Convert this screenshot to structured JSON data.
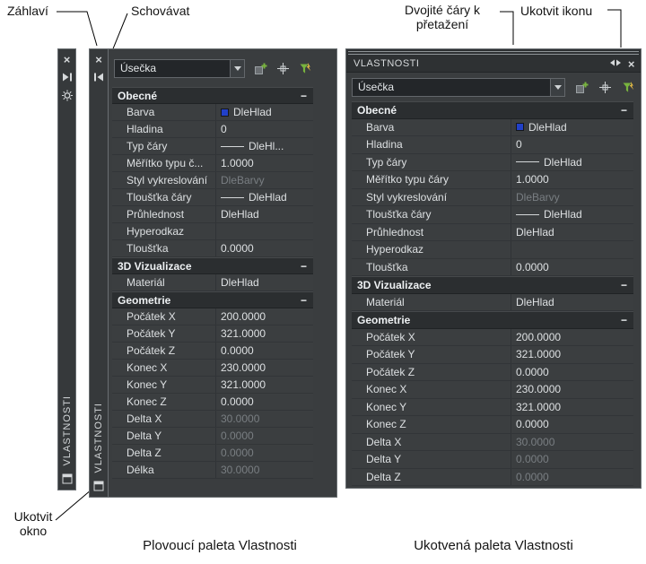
{
  "callouts": {
    "zahlavi": "Záhlaví",
    "schovavat": "Schovávat",
    "dvojite_line1": "Dvojité čáry k",
    "dvojite_line2": "přetažení",
    "ukotvit_ikonu": "Ukotvit ikonu",
    "ukotvit_okno_line1": "Ukotvit",
    "ukotvit_okno_line2": "okno"
  },
  "captions": {
    "floating": "Plovoucí paleta Vlastnosti",
    "docked": "Ukotvená paleta Vlastnosti"
  },
  "palette": {
    "title": "VLASTNOSTI",
    "selector_value": "Úsečka",
    "collapse_glyph": "−"
  },
  "icons": {
    "close": "×"
  },
  "colors": {
    "swatch_blue": "#2140c8",
    "quickselect_green": "#78b33e",
    "bolt_yellow": "#f0c246"
  },
  "floating": {
    "rows": [
      {
        "kind": "section",
        "label": "Obecné"
      },
      {
        "kind": "row",
        "label": "Barva",
        "value": "DleHlad",
        "swatch": true
      },
      {
        "kind": "row",
        "label": "Hladina",
        "value": "0"
      },
      {
        "kind": "row",
        "label": "Typ čáry",
        "value": "DleHl...",
        "line": true
      },
      {
        "kind": "row",
        "label": "Měřítko typu č...",
        "value": "1.0000"
      },
      {
        "kind": "row",
        "label": "Styl vykreslování",
        "value": "DleBarvy",
        "muted": true
      },
      {
        "kind": "row",
        "label": "Tloušťka čáry",
        "value": "DleHlad",
        "line": true
      },
      {
        "kind": "row",
        "label": "Průhlednost",
        "value": "DleHlad"
      },
      {
        "kind": "row",
        "label": "Hyperodkaz",
        "value": ""
      },
      {
        "kind": "row",
        "label": "Tloušťka",
        "value": "0.0000"
      },
      {
        "kind": "section",
        "label": "3D Vizualizace"
      },
      {
        "kind": "row",
        "label": "Materiál",
        "value": "DleHlad"
      },
      {
        "kind": "section",
        "label": "Geometrie"
      },
      {
        "kind": "row",
        "label": "Počátek X",
        "value": "200.0000"
      },
      {
        "kind": "row",
        "label": "Počátek Y",
        "value": "321.0000"
      },
      {
        "kind": "row",
        "label": "Počátek Z",
        "value": "0.0000"
      },
      {
        "kind": "row",
        "label": "Konec X",
        "value": "230.0000"
      },
      {
        "kind": "row",
        "label": "Konec Y",
        "value": "321.0000"
      },
      {
        "kind": "row",
        "label": "Konec Z",
        "value": "0.0000"
      },
      {
        "kind": "row",
        "label": "Delta X",
        "value": "30.0000",
        "muted": true
      },
      {
        "kind": "row",
        "label": "Delta Y",
        "value": "0.0000",
        "muted": true
      },
      {
        "kind": "row",
        "label": "Delta Z",
        "value": "0.0000",
        "muted": true
      },
      {
        "kind": "row",
        "label": "Délka",
        "value": "30.0000",
        "muted": true
      }
    ]
  },
  "docked": {
    "rows": [
      {
        "kind": "section",
        "label": "Obecné"
      },
      {
        "kind": "row",
        "label": "Barva",
        "value": "DleHlad",
        "swatch": true
      },
      {
        "kind": "row",
        "label": "Hladina",
        "value": "0"
      },
      {
        "kind": "row",
        "label": "Typ čáry",
        "value": "DleHlad",
        "line": true
      },
      {
        "kind": "row",
        "label": "Měřítko typu čáry",
        "value": "1.0000"
      },
      {
        "kind": "row",
        "label": "Styl vykreslování",
        "value": "DleBarvy",
        "muted": true
      },
      {
        "kind": "row",
        "label": "Tloušťka čáry",
        "value": "DleHlad",
        "line": true
      },
      {
        "kind": "row",
        "label": "Průhlednost",
        "value": "DleHlad"
      },
      {
        "kind": "row",
        "label": "Hyperodkaz",
        "value": ""
      },
      {
        "kind": "row",
        "label": "Tloušťka",
        "value": "0.0000"
      },
      {
        "kind": "section",
        "label": "3D Vizualizace"
      },
      {
        "kind": "row",
        "label": "Materiál",
        "value": "DleHlad"
      },
      {
        "kind": "section",
        "label": "Geometrie"
      },
      {
        "kind": "row",
        "label": "Počátek X",
        "value": "200.0000"
      },
      {
        "kind": "row",
        "label": "Počátek Y",
        "value": "321.0000"
      },
      {
        "kind": "row",
        "label": "Počátek Z",
        "value": "0.0000"
      },
      {
        "kind": "row",
        "label": "Konec X",
        "value": "230.0000"
      },
      {
        "kind": "row",
        "label": "Konec Y",
        "value": "321.0000"
      },
      {
        "kind": "row",
        "label": "Konec Z",
        "value": "0.0000"
      },
      {
        "kind": "row",
        "label": "Delta X",
        "value": "30.0000",
        "muted": true
      },
      {
        "kind": "row",
        "label": "Delta Y",
        "value": "0.0000",
        "muted": true
      },
      {
        "kind": "row",
        "label": "Delta Z",
        "value": "0.0000",
        "muted": true
      }
    ]
  }
}
